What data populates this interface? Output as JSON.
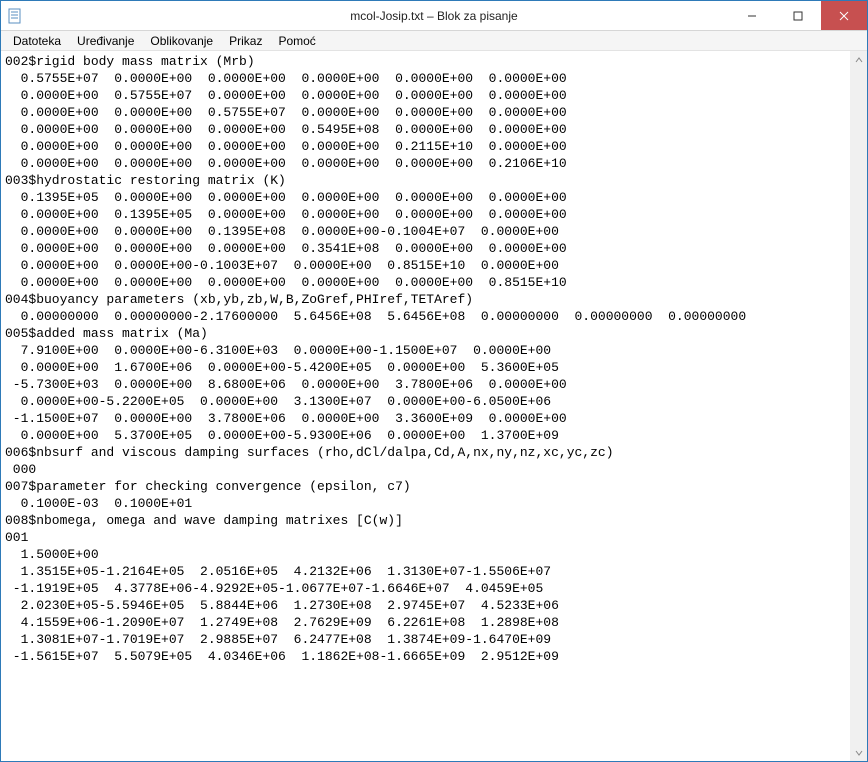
{
  "window": {
    "title": "mcol-Josip.txt – Blok za pisanje"
  },
  "menu": {
    "items": [
      "Datoteka",
      "Uređivanje",
      "Oblikovanje",
      "Prikaz",
      "Pomoć"
    ]
  },
  "editor": {
    "text": "002$rigid body mass matrix (Mrb)\n  0.5755E+07  0.0000E+00  0.0000E+00  0.0000E+00  0.0000E+00  0.0000E+00\n  0.0000E+00  0.5755E+07  0.0000E+00  0.0000E+00  0.0000E+00  0.0000E+00\n  0.0000E+00  0.0000E+00  0.5755E+07  0.0000E+00  0.0000E+00  0.0000E+00\n  0.0000E+00  0.0000E+00  0.0000E+00  0.5495E+08  0.0000E+00  0.0000E+00\n  0.0000E+00  0.0000E+00  0.0000E+00  0.0000E+00  0.2115E+10  0.0000E+00\n  0.0000E+00  0.0000E+00  0.0000E+00  0.0000E+00  0.0000E+00  0.2106E+10\n003$hydrostatic restoring matrix (K)\n  0.1395E+05  0.0000E+00  0.0000E+00  0.0000E+00  0.0000E+00  0.0000E+00\n  0.0000E+00  0.1395E+05  0.0000E+00  0.0000E+00  0.0000E+00  0.0000E+00\n  0.0000E+00  0.0000E+00  0.1395E+08  0.0000E+00-0.1004E+07  0.0000E+00\n  0.0000E+00  0.0000E+00  0.0000E+00  0.3541E+08  0.0000E+00  0.0000E+00\n  0.0000E+00  0.0000E+00-0.1003E+07  0.0000E+00  0.8515E+10  0.0000E+00\n  0.0000E+00  0.0000E+00  0.0000E+00  0.0000E+00  0.0000E+00  0.8515E+10\n004$buoyancy parameters (xb,yb,zb,W,B,ZoGref,PHIref,TETAref)\n  0.00000000  0.00000000-2.17600000  5.6456E+08  5.6456E+08  0.00000000  0.00000000  0.00000000\n005$added mass matrix (Ma)\n  7.9100E+00  0.0000E+00-6.3100E+03  0.0000E+00-1.1500E+07  0.0000E+00\n  0.0000E+00  1.6700E+06  0.0000E+00-5.4200E+05  0.0000E+00  5.3600E+05\n -5.7300E+03  0.0000E+00  8.6800E+06  0.0000E+00  3.7800E+06  0.0000E+00\n  0.0000E+00-5.2200E+05  0.0000E+00  3.1300E+07  0.0000E+00-6.0500E+06\n -1.1500E+07  0.0000E+00  3.7800E+06  0.0000E+00  3.3600E+09  0.0000E+00\n  0.0000E+00  5.3700E+05  0.0000E+00-5.9300E+06  0.0000E+00  1.3700E+09\n006$nbsurf and viscous damping surfaces (rho,dCl/dalpa,Cd,A,nx,ny,nz,xc,yc,zc)\n 000\n007$parameter for checking convergence (epsilon, c7)\n  0.1000E-03  0.1000E+01\n008$nbomega, omega and wave damping matrixes [C(w)]\n001\n  1.5000E+00\n  1.3515E+05-1.2164E+05  2.0516E+05  4.2132E+06  1.3130E+07-1.5506E+07\n -1.1919E+05  4.3778E+06-4.9292E+05-1.0677E+07-1.6646E+07  4.0459E+05\n  2.0230E+05-5.5946E+05  5.8844E+06  1.2730E+08  2.9745E+07  4.5233E+06\n  4.1559E+06-1.2090E+07  1.2749E+08  2.7629E+09  6.2261E+08  1.2898E+08\n  1.3081E+07-1.7019E+07  2.9885E+07  6.2477E+08  1.3874E+09-1.6470E+09\n -1.5615E+07  5.5079E+05  4.0346E+06  1.1862E+08-1.6665E+09  2.9512E+09"
  }
}
